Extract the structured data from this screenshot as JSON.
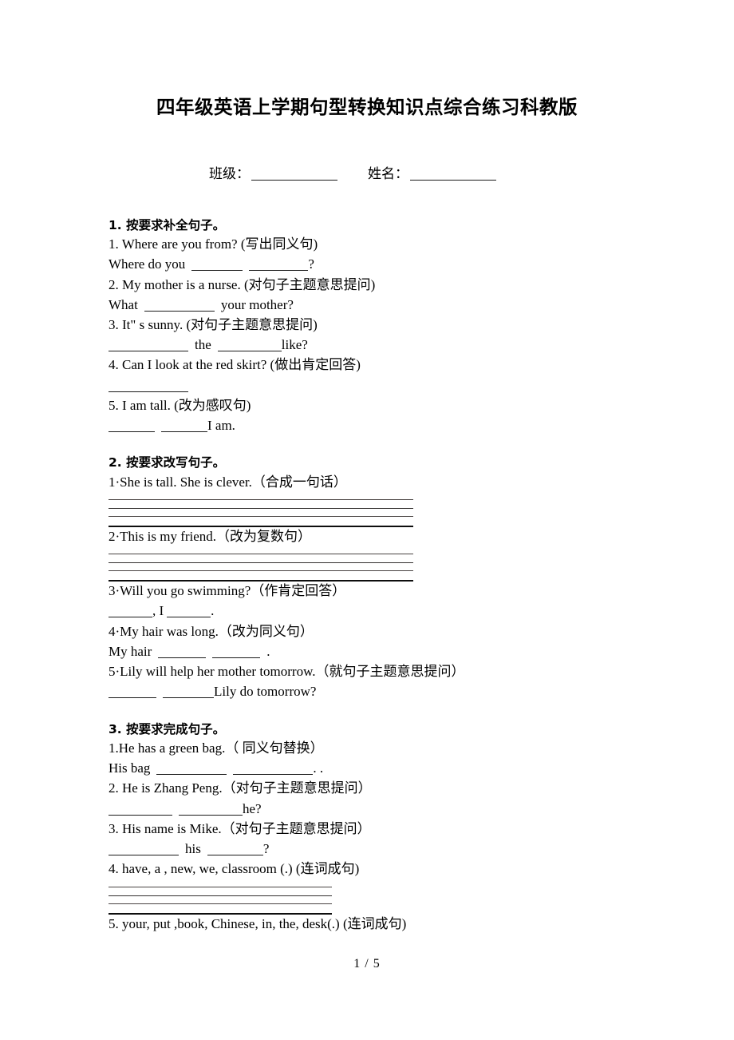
{
  "document": {
    "title": "四年级英语上学期句型转换知识点综合练习科教版",
    "meta": {
      "class_label": "班级：",
      "name_label": "姓名："
    },
    "footer": "1 / 5"
  },
  "sections": [
    {
      "heading": "1.  按要求补全句子。",
      "items": [
        {
          "prompt": "1. Where are you from? (写出同义句)",
          "answer_prefix": "Where do you",
          "answer_suffix": "?"
        },
        {
          "prompt": "2. My mother is a nurse. (对句子主题意思提问)",
          "answer_prefix": "What",
          "answer_suffix": "your mother?"
        },
        {
          "prompt": "3. It\" s sunny. (对句子主题意思提问)",
          "answer_mid": "the",
          "answer_suffix": "like?"
        },
        {
          "prompt": "4. Can I look at the red skirt? (做出肯定回答)",
          "answer_prefix": "",
          "answer_suffix": ""
        },
        {
          "prompt": "5. I am tall. (改为感叹句)",
          "answer_suffix": "I am."
        }
      ]
    },
    {
      "heading": "2.  按要求改写句子。",
      "items": [
        {
          "prompt": "1·She is tall. She is clever.（合成一句话）"
        },
        {
          "prompt": "2·This is my friend.（改为复数句）"
        },
        {
          "prompt": "3·Will you go swimming?（作肯定回答）",
          "answer_sep": ", I",
          "answer_suffix": "."
        },
        {
          "prompt": "4·My hair was long.（改为同义句）",
          "answer_prefix": "My hair",
          "answer_suffix": "."
        },
        {
          "prompt": "5·Lily will help her mother tomorrow.（就句子主题意思提问）",
          "answer_suffix": "Lily do tomorrow?"
        }
      ]
    },
    {
      "heading": "3.  按要求完成句子。",
      "items": [
        {
          "prompt": "1.He has a green bag.（ 同义句替换）",
          "answer_prefix": "His bag",
          "answer_suffix": ". ."
        },
        {
          "prompt": "2. He is Zhang Peng.（对句子主题意思提问）",
          "answer_suffix": "he?"
        },
        {
          "prompt": "3. His name is Mike.（对句子主题意思提问）",
          "answer_mid": "his",
          "answer_suffix": "?"
        },
        {
          "prompt": "4. have, a , new, we, classroom (.) (连词成句)"
        },
        {
          "prompt": "5. your, put ,book, Chinese, in, the, desk(.) (连词成句)"
        }
      ]
    }
  ]
}
